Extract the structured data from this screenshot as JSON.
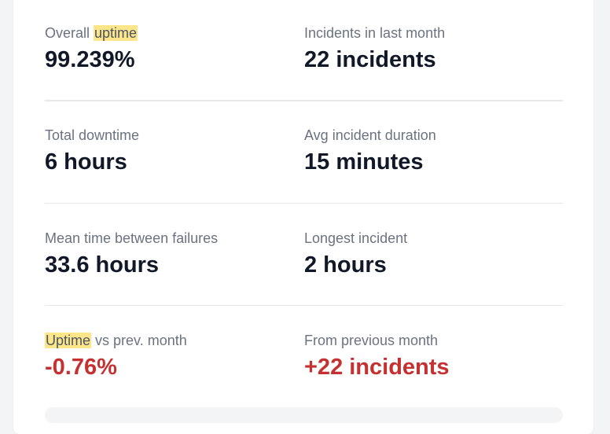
{
  "stats": [
    {
      "label_pre": "Overall ",
      "label_mark": "uptime",
      "label_post": "",
      "value": "99.239%"
    },
    {
      "label_pre": "Incidents in last month",
      "label_mark": "",
      "label_post": "",
      "value": "22 incidents"
    },
    {
      "label_pre": "Total downtime",
      "label_mark": "",
      "label_post": "",
      "value": "6 hours"
    },
    {
      "label_pre": "Avg incident duration",
      "label_mark": "",
      "label_post": "",
      "value": "15 minutes"
    },
    {
      "label_pre": "Mean time between failures",
      "label_mark": "",
      "label_post": "",
      "value": "33.6 hours"
    },
    {
      "label_pre": "Longest incident",
      "label_mark": "",
      "label_post": "",
      "value": "2 hours"
    },
    {
      "label_pre": "",
      "label_mark": "Uptime",
      "label_post": " vs prev. month",
      "value": "-0.76%"
    },
    {
      "label_pre": "From previous month",
      "label_mark": "",
      "label_post": "",
      "value": "+22 incidents"
    }
  ],
  "colors": {
    "highlight": "#fde68a",
    "negative": "#c53030",
    "value": "#111827",
    "label": "#6b7280"
  }
}
